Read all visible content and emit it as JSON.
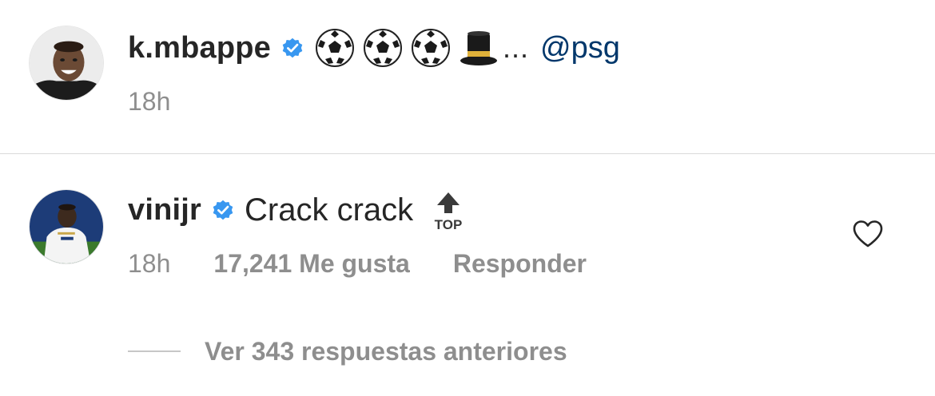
{
  "caption": {
    "avatar_icon": "avatar-kmbappe",
    "username": "k.mbappe",
    "verified_icon": "verified-badge-icon",
    "emojis": [
      "soccer-ball-icon",
      "soccer-ball-icon",
      "soccer-ball-icon",
      "top-hat-icon"
    ],
    "ellipsis": "...",
    "mention": "@psg",
    "time": "18h"
  },
  "comment": {
    "avatar_icon": "avatar-vinijr",
    "username": "vinijr",
    "verified_icon": "verified-badge-icon",
    "text": "Crack crack",
    "top_emoji_label": "TOP",
    "time": "18h",
    "likes": "17,241 Me gusta",
    "reply_label": "Responder",
    "like_icon": "heart-outline-icon"
  },
  "replies": {
    "view_label": "Ver 343 respuestas anteriores"
  },
  "colors": {
    "text_primary": "#262626",
    "text_secondary": "#8e8e8e",
    "mention": "#00376b",
    "verified": "#3897f0",
    "divider": "#dbdbdb"
  }
}
